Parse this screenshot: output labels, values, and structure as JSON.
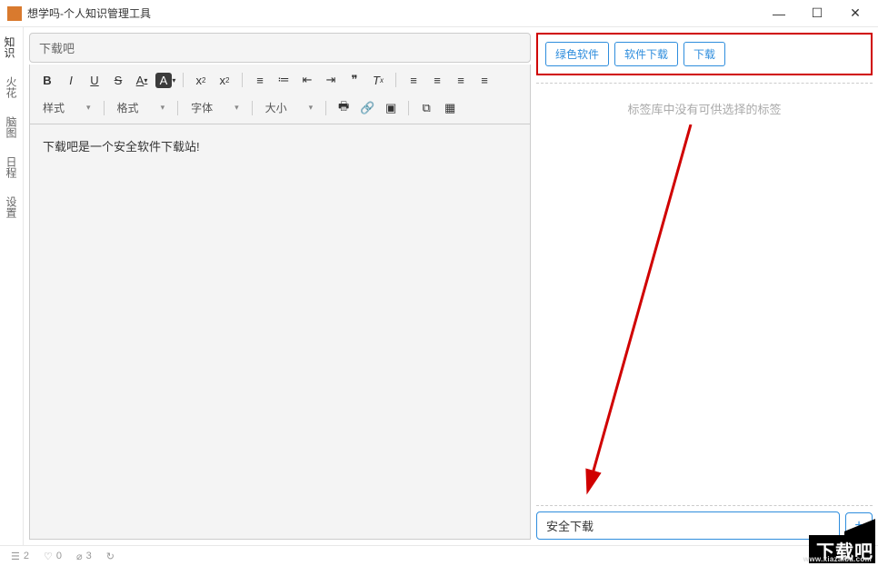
{
  "app": {
    "title": "想学吗-个人知识管理工具"
  },
  "sidebar": {
    "items": [
      {
        "label": "知识"
      },
      {
        "label": "火花"
      },
      {
        "label": "脑图"
      },
      {
        "label": "日程"
      },
      {
        "label": "设置"
      }
    ]
  },
  "editor": {
    "title_value": "下载吧",
    "body": "下载吧是一个安全软件下载站!",
    "dropdowns": {
      "style": "样式",
      "format": "格式",
      "font": "字体",
      "size": "大小"
    }
  },
  "tags": {
    "active": [
      "绿色软件",
      "软件下载",
      "下载"
    ],
    "empty_msg": "标签库中没有可供选择的标签",
    "input_value": "安全下载",
    "add_label": "+"
  },
  "status": {
    "count1": "2",
    "count2": "0",
    "count3": "3",
    "bug_label": "Bug"
  },
  "watermark": {
    "main": "下载吧",
    "sub": "www.xiazaiba.com"
  }
}
